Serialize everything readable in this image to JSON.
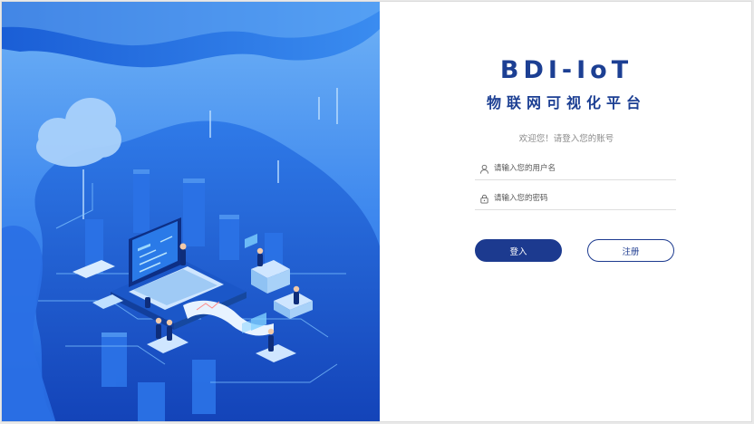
{
  "brand": {
    "title": "BDI-IoT",
    "subtitle": "物联网可视化平台"
  },
  "login": {
    "welcome": "欢迎您！请登入您的账号",
    "username_placeholder": "请输入您的用户名",
    "password_placeholder": "请输入您的密码",
    "login_label": "登入",
    "register_label": "注册"
  },
  "icons": {
    "username": "user-icon",
    "password": "lock-icon"
  },
  "colors": {
    "brand": "#1c3f93",
    "primary_button": "#1c3a8f",
    "hero_blue": "#1f63e0"
  }
}
